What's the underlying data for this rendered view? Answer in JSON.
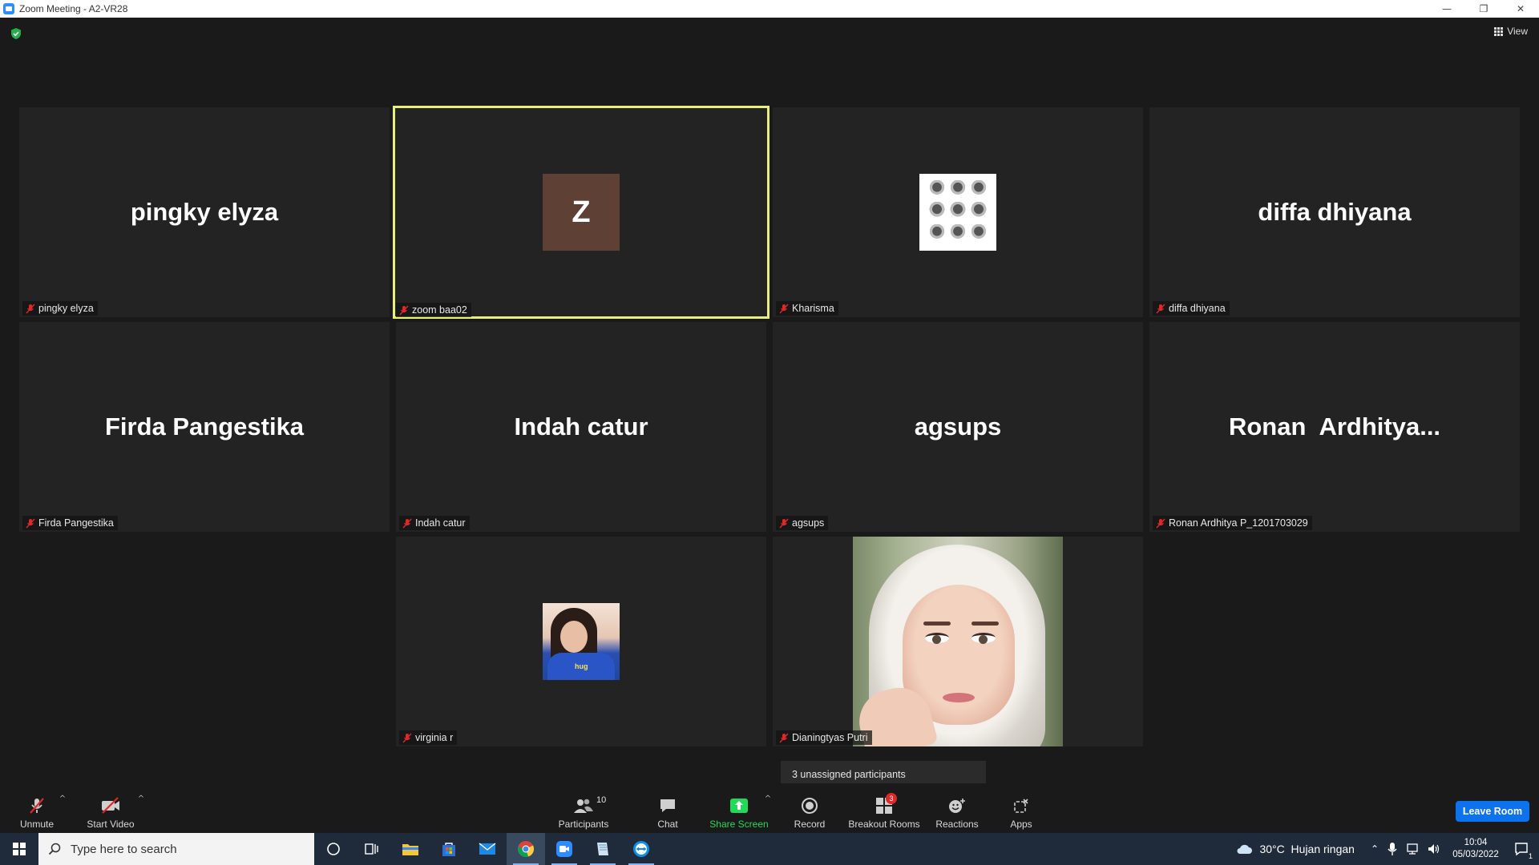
{
  "window": {
    "title": "Zoom Meeting - A2-VR28",
    "minimize": "—",
    "restore": "❐",
    "close": "✕"
  },
  "top": {
    "view_label": "View"
  },
  "tiles": [
    {
      "display": "pingky elyza",
      "label": "pingky elyza"
    },
    {
      "avatar_letter": "Z",
      "label": "zoom baa02",
      "active_speaker": true
    },
    {
      "label": "Kharisma"
    },
    {
      "display": "diffa dhiyana",
      "label": "diffa dhiyana"
    },
    {
      "display": "Firda Pangestika",
      "label": "Firda Pangestika"
    },
    {
      "display": "Indah catur",
      "label": "Indah catur"
    },
    {
      "display": "agsups",
      "label": "agsups"
    },
    {
      "display": "Ronan  Ardhitya...",
      "label": "Ronan Ardhitya P_1201703029"
    },
    {
      "label": "virginia r",
      "avatar_text": "hug"
    },
    {
      "label": "Dianingtyas Putri"
    }
  ],
  "tooltip": "3 unassigned participants",
  "toolbar": {
    "unmute": "Unmute",
    "start_video": "Start Video",
    "participants": "Participants",
    "participants_count": "10",
    "chat": "Chat",
    "share_screen": "Share Screen",
    "record": "Record",
    "breakout_rooms": "Breakout Rooms",
    "breakout_badge": "3",
    "reactions": "Reactions",
    "apps": "Apps",
    "leave_room": "Leave Room",
    "caret": "^"
  },
  "taskbar": {
    "search_placeholder": "Type here to search",
    "weather": "30°C  Hujan ringan",
    "time": "10:04",
    "date": "05/03/2022",
    "notification_count": "1"
  },
  "colors": {
    "accent_blue": "#0e72ed",
    "share_green": "#23d959",
    "active_speaker": "#e8f07a",
    "muted_red": "#e02828"
  }
}
